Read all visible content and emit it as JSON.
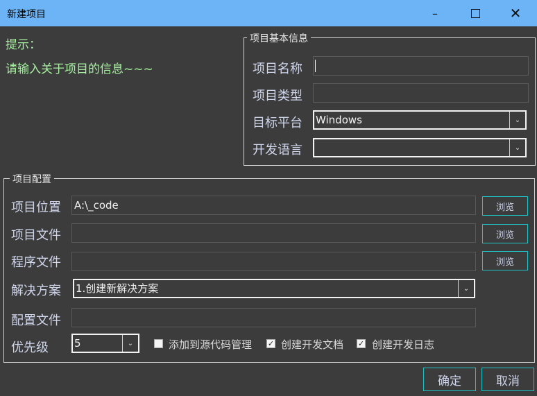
{
  "window": {
    "title": "新建项目",
    "min_icon": "minimize-icon",
    "max_icon": "maximize-icon",
    "close_icon": "close-icon"
  },
  "hint": {
    "label": "提示：",
    "text": "请输入关于项目的信息~~~"
  },
  "basic_info": {
    "legend": "项目基本信息",
    "name_label": "项目名称",
    "name_value": "",
    "type_label": "项目类型",
    "type_value": "",
    "platform_label": "目标平台",
    "platform_value": "Windows",
    "language_label": "开发语言",
    "language_value": ""
  },
  "config": {
    "legend": "项目配置",
    "location_label": "项目位置",
    "location_value": "A:\\_code",
    "project_file_label": "项目文件",
    "project_file_value": "",
    "program_file_label": "程序文件",
    "program_file_value": "",
    "solution_label": "解决方案",
    "solution_value": "1.创建新解决方案",
    "config_file_label": "配置文件",
    "config_file_value": "",
    "priority_label": "优先级",
    "priority_value": "5",
    "browse_label": "浏览",
    "checkboxes": [
      {
        "label": "添加到源代码管理",
        "checked": false
      },
      {
        "label": "创建开发文档",
        "checked": true
      },
      {
        "label": "创建开发日志",
        "checked": true
      }
    ]
  },
  "actions": {
    "ok": "确定",
    "cancel": "取消"
  },
  "colors": {
    "titlebar": "#6cb4f5",
    "background": "#3c3c3c",
    "hint_text": "#a6f0a0",
    "accent_border": "#1fc8c8"
  }
}
